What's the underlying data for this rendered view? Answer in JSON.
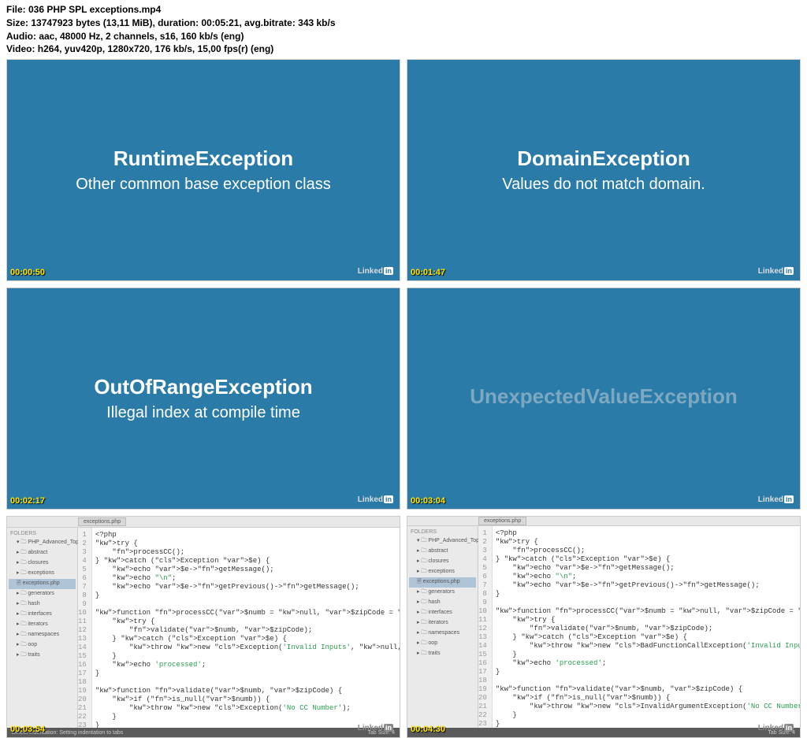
{
  "meta": {
    "line1": "File: 036 PHP SPL exceptions.mp4",
    "line2": "Size: 13747923 bytes (13,11 MiB), duration: 00:05:21, avg.bitrate: 343 kb/s",
    "line3": "Audio: aac, 48000 Hz, 2 channels, s16, 160 kb/s (eng)",
    "line4": "Video: h264, yuv420p, 1280x720, 176 kb/s, 15,00 fps(r) (eng)"
  },
  "tiles": [
    {
      "title": "RuntimeException",
      "sub": "Other common base exception class",
      "ts": "00:00:50"
    },
    {
      "title": "DomainException",
      "sub": "Values do not match domain.",
      "ts": "00:01:47"
    },
    {
      "title": "OutOfRangeException",
      "sub": "Illegal index at compile time",
      "ts": "00:02:17"
    },
    {
      "title": "UnexpectedValueException",
      "sub": "",
      "ts": "00:03:04",
      "faded": true
    }
  ],
  "linkedin": "Linked",
  "sidebar": {
    "header": "FOLDERS",
    "root": "PHP_Advanced_Topics",
    "items": [
      "abstract",
      "closures",
      "exceptions",
      "generators",
      "hash",
      "interfaces",
      "iterators",
      "namespaces",
      "oop",
      "traits"
    ]
  },
  "tab": "exceptions.php",
  "status_left": "Detect indentation: Setting indentation to tabs",
  "status_right": "Tab Size: 4",
  "code5": {
    "ts": "00:03:54",
    "lines": [
      "<?php",
      "try {",
      "    processCC();",
      "} catch (Exception $e) {",
      "    echo $e->getMessage();",
      "    echo \"\\n\";",
      "    echo $e->getPrevious()->getMessage();",
      "}",
      "",
      "function processCC($numb = null, $zipCode = null) {",
      "    try {",
      "        validate($numb, $zipCode);",
      "    } catch (Exception $e) {",
      "        throw new Exception('Invalid Inputs', null, $e);",
      "    }",
      "    echo 'processed';",
      "}",
      "",
      "function validate($numb, $zipCode) {",
      "    if (is_null($numb)) {",
      "        throw new Exception('No CC Number');",
      "    }",
      "}"
    ]
  },
  "code6": {
    "ts": "00:04:30",
    "lines": [
      "<?php",
      "try {",
      "    processCC();",
      "} catch (Exception $e) {",
      "    echo $e->getMessage();",
      "",
      "    echo \"\\n\";",
      "    echo $e->getPrevious()->getMessage();",
      "}",
      "",
      "function processCC($numb = null, $zipCode = null) {",
      "    try {",
      "        validate($numb, $zipCode);",
      "    } catch (Exception $e) {",
      "        throw new BadFunctionCallException('Invalid Inputs', null, $e);",
      "    }",
      "    echo 'processed';",
      "}",
      "",
      "function validate($numb, $zipCode) {",
      "    if (is_null($numb)) {",
      "        throw new InvalidArgumentException('No CC Number');",
      "    }",
      "}"
    ]
  }
}
